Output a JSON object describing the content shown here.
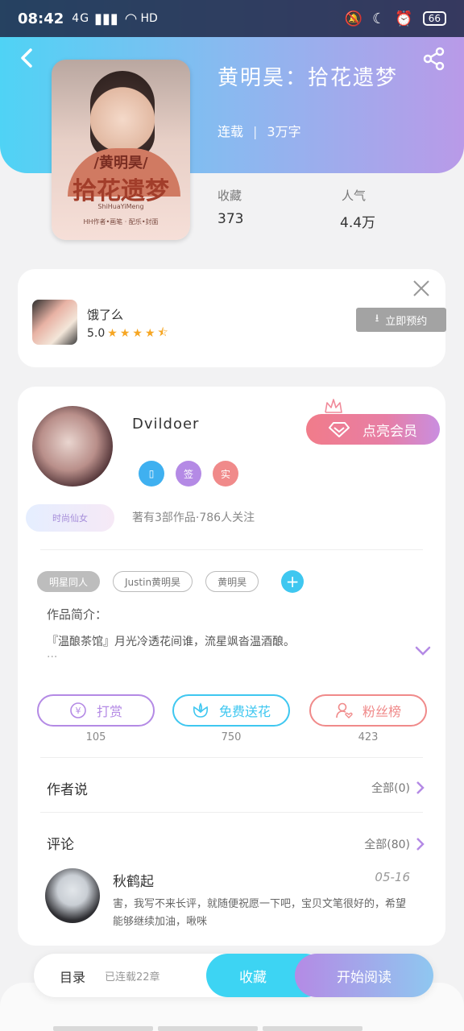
{
  "status_bar": {
    "time": "08:42",
    "signal": "4G",
    "network": "HD",
    "battery": "66"
  },
  "book": {
    "title": "黄明昊：拾花遗梦",
    "status": "连载",
    "word_count": "3万字",
    "collect_label": "收藏",
    "collect_value": "373",
    "popularity_label": "人气",
    "popularity_value": "4.4万",
    "cover": {
      "title_top": "/黄明昊/",
      "title_main": "拾花遗梦",
      "subtitle": "ShiHuaYiMeng",
      "footer": "HH作者•画笔 · 配乐•封面"
    }
  },
  "ad": {
    "name": "饿了么",
    "rating": "5.0",
    "button_label": "立即预约"
  },
  "author": {
    "name": "Dvildoer",
    "vip_button": "点亮会员",
    "badges": [
      "",
      "签",
      "实"
    ],
    "title_tag": "时尚仙女",
    "stats": "著有3部作品·786人关注",
    "tags": [
      "明星同人",
      "Justin黄明昊",
      "黄明昊"
    ],
    "intro_label": "作品简介：",
    "intro_text": "『温酿茶馆』月光冷透花间谁，流星飒沓温酒酿。",
    "intro_more": "..."
  },
  "actions": [
    {
      "label": "打赏",
      "count": "105",
      "color": "#b48ae5"
    },
    {
      "label": "免费送花",
      "count": "750",
      "color": "#3fc7f0"
    },
    {
      "label": "粉丝榜",
      "count": "423",
      "color": "#f08a8a"
    }
  ],
  "author_says": {
    "title": "作者说",
    "link": "全部(0)"
  },
  "comments": {
    "title": "评论",
    "link": "全部(80)",
    "items": [
      {
        "name": "秋鹤起",
        "date": "05-16",
        "text": "害，我写不来长评，就随便祝愿一下吧，宝贝文笔很好的，希望能够继续加油，啾咪"
      }
    ]
  },
  "bottom_bar": {
    "toc": "目录",
    "progress": "已连载22章",
    "collect": "收藏",
    "read": "开始阅读"
  }
}
